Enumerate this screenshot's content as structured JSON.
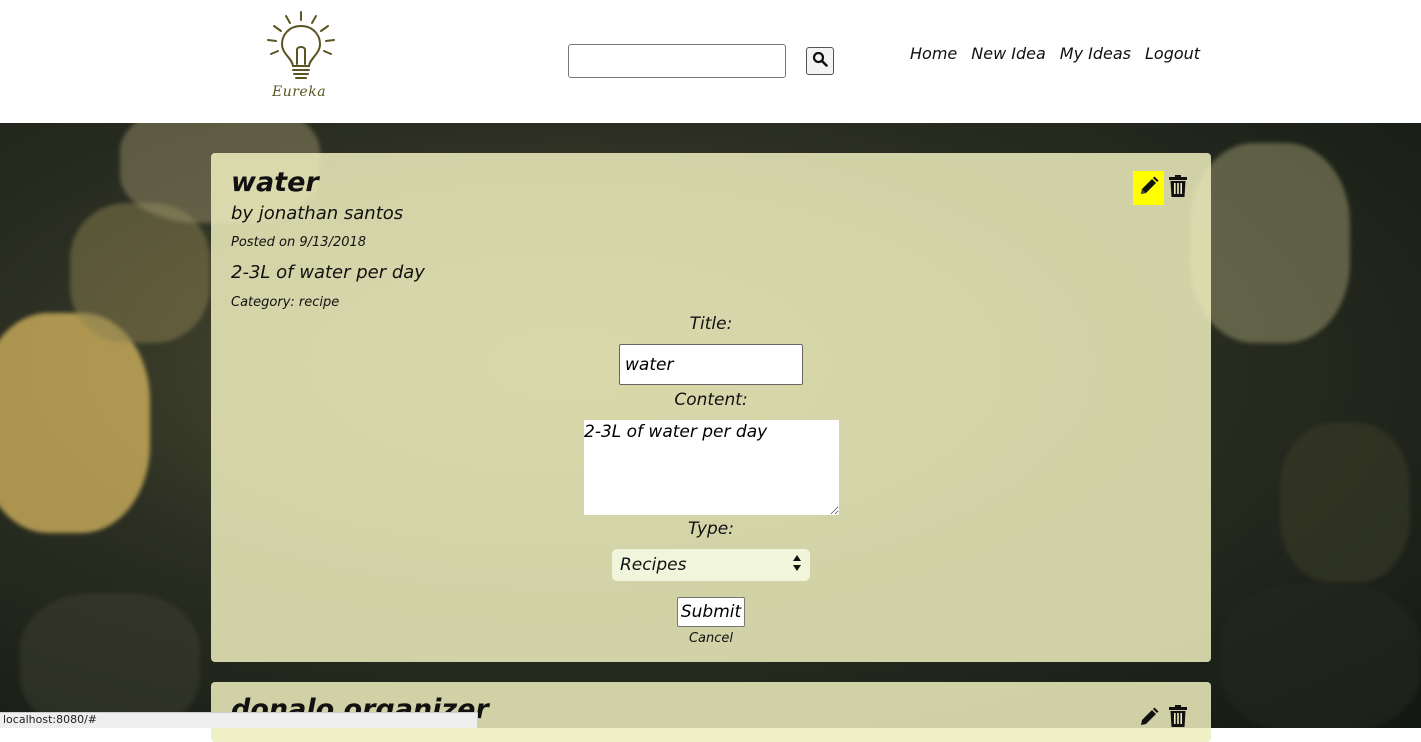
{
  "header": {
    "logo_text": "Eureka",
    "search": {
      "value": "",
      "placeholder": ""
    },
    "search_icon": "search-icon",
    "nav": [
      {
        "label": "Home"
      },
      {
        "label": "New Idea"
      },
      {
        "label": "My Ideas"
      },
      {
        "label": "Logout"
      }
    ]
  },
  "idea": {
    "title": "water",
    "author": "by jonathan santos",
    "posted": "Posted on 9/13/2018",
    "content": "2-3L of water per day",
    "category": "Category: recipe",
    "edit_icon": "pencil-icon",
    "delete_icon": "trash-icon",
    "edit_active_color": "#ffff00"
  },
  "edit_form": {
    "title_label": "Title:",
    "title_value": "water",
    "content_label": "Content:",
    "content_value": "2-3L of water per day",
    "type_label": "Type:",
    "type_value": "Recipes",
    "submit_label": "Submit",
    "cancel_label": "Cancel"
  },
  "next_idea": {
    "title": "donalo organizer"
  },
  "status_bar": {
    "url": "localhost:8080/#"
  },
  "colors": {
    "card_bg": "#eeeebe",
    "page_bg": "#2c2f22"
  }
}
